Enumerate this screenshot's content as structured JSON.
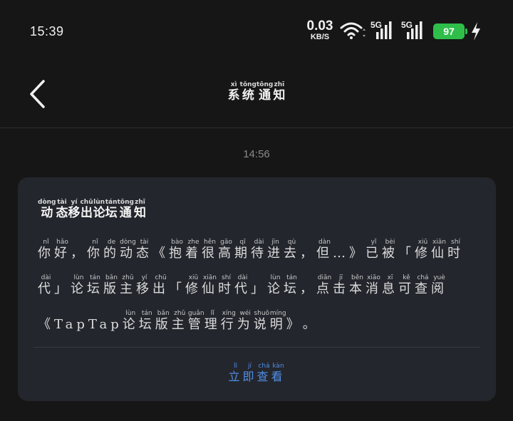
{
  "status_bar": {
    "time": "15:39",
    "net_speed_value": "0.03",
    "net_speed_unit": "KB/S",
    "signal1_label": "5G",
    "signal2_label": "5G",
    "battery_level": "97"
  },
  "header": {
    "title_chars": [
      {
        "c": "系",
        "p": "xì"
      },
      {
        "c": "统",
        "p": "tǒng"
      },
      {
        "c": "通",
        "p": "tōng"
      },
      {
        "c": "知",
        "p": "zhī"
      }
    ]
  },
  "message": {
    "timestamp": "14:56",
    "title_chars": [
      {
        "c": "动",
        "p": "dòng"
      },
      {
        "c": "态",
        "p": "tài"
      },
      {
        "c": "移",
        "p": "yí"
      },
      {
        "c": "出",
        "p": "chū"
      },
      {
        "c": "论",
        "p": "lùn"
      },
      {
        "c": "坛",
        "p": "tán"
      },
      {
        "c": "通",
        "p": "tōng"
      },
      {
        "c": "知",
        "p": "zhī"
      }
    ],
    "body_chars": [
      {
        "c": "你",
        "p": "nǐ"
      },
      {
        "c": "好",
        "p": "hǎo"
      },
      {
        "c": "，",
        "p": ""
      },
      {
        "c": "你",
        "p": "nǐ"
      },
      {
        "c": "的",
        "p": "de"
      },
      {
        "c": "动",
        "p": "dòng"
      },
      {
        "c": "态",
        "p": "tài"
      },
      {
        "c": "《",
        "p": ""
      },
      {
        "c": "抱",
        "p": "bào"
      },
      {
        "c": "着",
        "p": "zhe"
      },
      {
        "c": "很",
        "p": "hěn"
      },
      {
        "c": "高",
        "p": "gāo"
      },
      {
        "c": "期",
        "p": "qī"
      },
      {
        "c": "待",
        "p": "dài"
      },
      {
        "c": "进",
        "p": "jìn"
      },
      {
        "c": "去",
        "p": "qù"
      },
      {
        "c": "，",
        "p": ""
      },
      {
        "c": "但",
        "p": "dàn"
      },
      {
        "c": "…",
        "p": ""
      },
      {
        "c": "》",
        "p": ""
      },
      {
        "c": "已",
        "p": "yǐ"
      },
      {
        "c": "被",
        "p": "bèi"
      },
      {
        "c": "「",
        "p": ""
      },
      {
        "c": "修",
        "p": "xiū"
      },
      {
        "c": "仙",
        "p": "xiān"
      },
      {
        "c": "时",
        "p": "shí"
      },
      {
        "c": "代",
        "p": "dài"
      },
      {
        "c": "」",
        "p": ""
      },
      {
        "c": "论",
        "p": "lùn"
      },
      {
        "c": "坛",
        "p": "tán"
      },
      {
        "c": "版",
        "p": "bǎn"
      },
      {
        "c": "主",
        "p": "zhǔ"
      },
      {
        "c": "移",
        "p": "yí"
      },
      {
        "c": "出",
        "p": "chū"
      },
      {
        "c": "「",
        "p": ""
      },
      {
        "c": "修",
        "p": "xiū"
      },
      {
        "c": "仙",
        "p": "xiān"
      },
      {
        "c": "时",
        "p": "shí"
      },
      {
        "c": "代",
        "p": "dài"
      },
      {
        "c": "」",
        "p": ""
      },
      {
        "c": "论",
        "p": "lùn"
      },
      {
        "c": "坛",
        "p": "tán"
      },
      {
        "c": "，",
        "p": ""
      },
      {
        "c": "点",
        "p": "diǎn"
      },
      {
        "c": "击",
        "p": "jī"
      },
      {
        "c": "本",
        "p": "běn"
      },
      {
        "c": "消",
        "p": "xiāo"
      },
      {
        "c": "息",
        "p": "xī"
      },
      {
        "c": "可",
        "p": "kě"
      },
      {
        "c": "查",
        "p": "chá"
      },
      {
        "c": "阅",
        "p": "yuè"
      },
      {
        "c": "《",
        "p": ""
      },
      {
        "c": "TapTap",
        "p": ""
      },
      {
        "c": "论",
        "p": "lùn"
      },
      {
        "c": "坛",
        "p": "tán"
      },
      {
        "c": "版",
        "p": "bǎn"
      },
      {
        "c": "主",
        "p": "zhǔ"
      },
      {
        "c": "管",
        "p": "guǎn"
      },
      {
        "c": "理",
        "p": "lǐ"
      },
      {
        "c": "行",
        "p": "xíng"
      },
      {
        "c": "为",
        "p": "wéi"
      },
      {
        "c": "说",
        "p": "shuō"
      },
      {
        "c": "明",
        "p": "míng"
      },
      {
        "c": "》",
        "p": ""
      },
      {
        "c": "。",
        "p": ""
      }
    ],
    "action_chars": [
      {
        "c": "立",
        "p": "lì"
      },
      {
        "c": "即",
        "p": "jí"
      },
      {
        "c": "查",
        "p": "chá"
      },
      {
        "c": "看",
        "p": "kàn"
      }
    ]
  },
  "colors": {
    "background": "#161616",
    "card": "#24262d",
    "accent": "#4f8fe6",
    "battery": "#2fbe4a"
  },
  "icons": [
    "wifi-icon",
    "signal-icon",
    "battery-icon",
    "charging-bolt-icon",
    "back-arrow-icon"
  ]
}
